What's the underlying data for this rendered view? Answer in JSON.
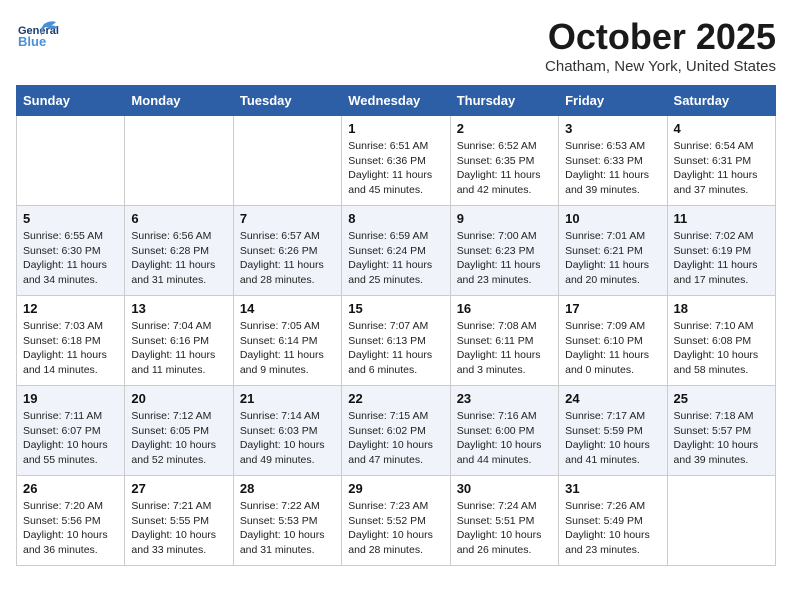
{
  "header": {
    "logo_general": "General",
    "logo_blue": "Blue",
    "month": "October 2025",
    "location": "Chatham, New York, United States"
  },
  "days_of_week": [
    "Sunday",
    "Monday",
    "Tuesday",
    "Wednesday",
    "Thursday",
    "Friday",
    "Saturday"
  ],
  "weeks": [
    [
      {
        "day": "",
        "text": ""
      },
      {
        "day": "",
        "text": ""
      },
      {
        "day": "",
        "text": ""
      },
      {
        "day": "1",
        "text": "Sunrise: 6:51 AM\nSunset: 6:36 PM\nDaylight: 11 hours and 45 minutes."
      },
      {
        "day": "2",
        "text": "Sunrise: 6:52 AM\nSunset: 6:35 PM\nDaylight: 11 hours and 42 minutes."
      },
      {
        "day": "3",
        "text": "Sunrise: 6:53 AM\nSunset: 6:33 PM\nDaylight: 11 hours and 39 minutes."
      },
      {
        "day": "4",
        "text": "Sunrise: 6:54 AM\nSunset: 6:31 PM\nDaylight: 11 hours and 37 minutes."
      }
    ],
    [
      {
        "day": "5",
        "text": "Sunrise: 6:55 AM\nSunset: 6:30 PM\nDaylight: 11 hours and 34 minutes."
      },
      {
        "day": "6",
        "text": "Sunrise: 6:56 AM\nSunset: 6:28 PM\nDaylight: 11 hours and 31 minutes."
      },
      {
        "day": "7",
        "text": "Sunrise: 6:57 AM\nSunset: 6:26 PM\nDaylight: 11 hours and 28 minutes."
      },
      {
        "day": "8",
        "text": "Sunrise: 6:59 AM\nSunset: 6:24 PM\nDaylight: 11 hours and 25 minutes."
      },
      {
        "day": "9",
        "text": "Sunrise: 7:00 AM\nSunset: 6:23 PM\nDaylight: 11 hours and 23 minutes."
      },
      {
        "day": "10",
        "text": "Sunrise: 7:01 AM\nSunset: 6:21 PM\nDaylight: 11 hours and 20 minutes."
      },
      {
        "day": "11",
        "text": "Sunrise: 7:02 AM\nSunset: 6:19 PM\nDaylight: 11 hours and 17 minutes."
      }
    ],
    [
      {
        "day": "12",
        "text": "Sunrise: 7:03 AM\nSunset: 6:18 PM\nDaylight: 11 hours and 14 minutes."
      },
      {
        "day": "13",
        "text": "Sunrise: 7:04 AM\nSunset: 6:16 PM\nDaylight: 11 hours and 11 minutes."
      },
      {
        "day": "14",
        "text": "Sunrise: 7:05 AM\nSunset: 6:14 PM\nDaylight: 11 hours and 9 minutes."
      },
      {
        "day": "15",
        "text": "Sunrise: 7:07 AM\nSunset: 6:13 PM\nDaylight: 11 hours and 6 minutes."
      },
      {
        "day": "16",
        "text": "Sunrise: 7:08 AM\nSunset: 6:11 PM\nDaylight: 11 hours and 3 minutes."
      },
      {
        "day": "17",
        "text": "Sunrise: 7:09 AM\nSunset: 6:10 PM\nDaylight: 11 hours and 0 minutes."
      },
      {
        "day": "18",
        "text": "Sunrise: 7:10 AM\nSunset: 6:08 PM\nDaylight: 10 hours and 58 minutes."
      }
    ],
    [
      {
        "day": "19",
        "text": "Sunrise: 7:11 AM\nSunset: 6:07 PM\nDaylight: 10 hours and 55 minutes."
      },
      {
        "day": "20",
        "text": "Sunrise: 7:12 AM\nSunset: 6:05 PM\nDaylight: 10 hours and 52 minutes."
      },
      {
        "day": "21",
        "text": "Sunrise: 7:14 AM\nSunset: 6:03 PM\nDaylight: 10 hours and 49 minutes."
      },
      {
        "day": "22",
        "text": "Sunrise: 7:15 AM\nSunset: 6:02 PM\nDaylight: 10 hours and 47 minutes."
      },
      {
        "day": "23",
        "text": "Sunrise: 7:16 AM\nSunset: 6:00 PM\nDaylight: 10 hours and 44 minutes."
      },
      {
        "day": "24",
        "text": "Sunrise: 7:17 AM\nSunset: 5:59 PM\nDaylight: 10 hours and 41 minutes."
      },
      {
        "day": "25",
        "text": "Sunrise: 7:18 AM\nSunset: 5:57 PM\nDaylight: 10 hours and 39 minutes."
      }
    ],
    [
      {
        "day": "26",
        "text": "Sunrise: 7:20 AM\nSunset: 5:56 PM\nDaylight: 10 hours and 36 minutes."
      },
      {
        "day": "27",
        "text": "Sunrise: 7:21 AM\nSunset: 5:55 PM\nDaylight: 10 hours and 33 minutes."
      },
      {
        "day": "28",
        "text": "Sunrise: 7:22 AM\nSunset: 5:53 PM\nDaylight: 10 hours and 31 minutes."
      },
      {
        "day": "29",
        "text": "Sunrise: 7:23 AM\nSunset: 5:52 PM\nDaylight: 10 hours and 28 minutes."
      },
      {
        "day": "30",
        "text": "Sunrise: 7:24 AM\nSunset: 5:51 PM\nDaylight: 10 hours and 26 minutes."
      },
      {
        "day": "31",
        "text": "Sunrise: 7:26 AM\nSunset: 5:49 PM\nDaylight: 10 hours and 23 minutes."
      },
      {
        "day": "",
        "text": ""
      }
    ]
  ]
}
